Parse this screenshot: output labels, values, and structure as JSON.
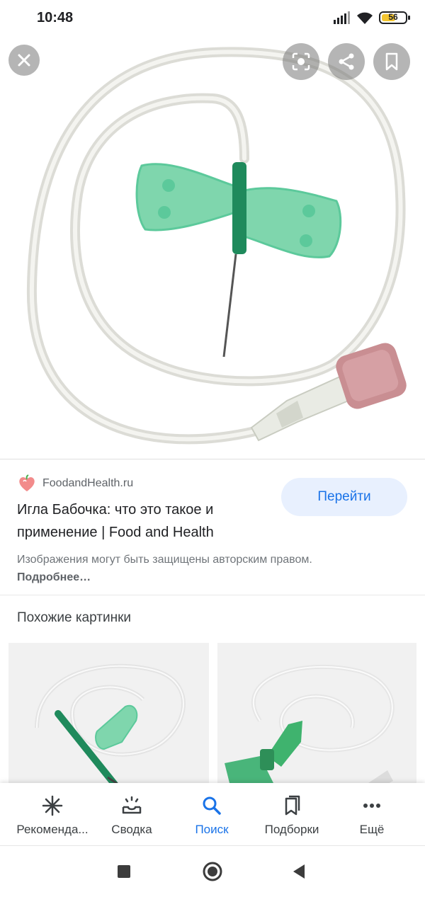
{
  "status_bar": {
    "time": "10:48",
    "battery": "56"
  },
  "viewer": {
    "close_icon": "close-icon",
    "lens_icon": "google-lens-icon",
    "share_icon": "share-icon",
    "bookmark_icon": "bookmark-icon"
  },
  "result": {
    "source_name": "FoodandHealth.ru",
    "visit_label": "Перейти",
    "title": "Игла Бабочка: что это такое и применение | Food and Health",
    "copyright_note": "Изображения могут быть защищены авторским правом.",
    "more_link": "Подробнее…"
  },
  "similar": {
    "heading": "Похожие картинки"
  },
  "bottom_nav": {
    "items": [
      {
        "label": "Рекоменда...",
        "icon": "asterisk-icon"
      },
      {
        "label": "Сводка",
        "icon": "inbox-tray-icon"
      },
      {
        "label": "Поиск",
        "icon": "search-icon",
        "active": true
      },
      {
        "label": "Подборки",
        "icon": "collections-icon"
      },
      {
        "label": "Ещё",
        "icon": "more-dots-icon"
      }
    ]
  },
  "colors": {
    "accent": "#1a73e8",
    "accent_bg": "#e8f0fe",
    "needle_green": "#5cc99b",
    "cap_pink": "#c98e92"
  }
}
